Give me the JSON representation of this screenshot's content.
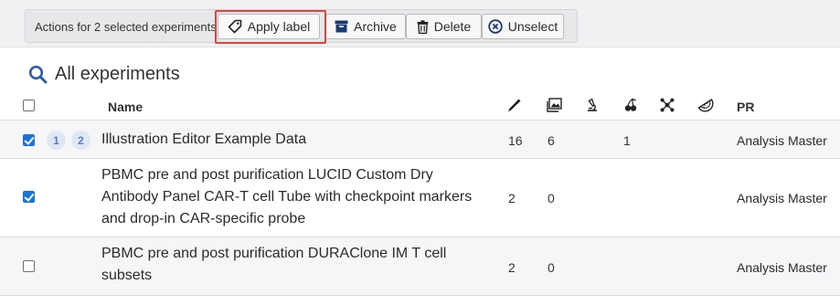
{
  "action_bar": {
    "label": "Actions for 2 selected experiments",
    "apply_label": "Apply label",
    "archive": "Archive",
    "delete": "Delete",
    "unselect": "Unselect"
  },
  "section": {
    "title": "All experiments"
  },
  "table": {
    "headers": {
      "name": "Name",
      "pr": "PR",
      "icons": [
        "pipette-icon",
        "image-gallery-icon",
        "microscope-icon",
        "cherries-icon",
        "network-nodes-icon",
        "melon-slice-icon"
      ]
    },
    "rows": [
      {
        "checked": true,
        "badges": [
          "1",
          "2"
        ],
        "name": "Illustration Editor Example Data",
        "col1": "16",
        "col2": "6",
        "col4": "1",
        "pr": "Analysis Master"
      },
      {
        "checked": true,
        "name_lines": [
          "PBMC pre and post purification LUCID Custom Dry",
          "Antibody Panel CAR-T cell Tube with checkpoint markers",
          "and drop-in CAR-specific probe"
        ],
        "col1": "2",
        "col2": "0",
        "pr": "Analysis Master"
      },
      {
        "checked": false,
        "name_lines": [
          "PBMC pre and post purification DURAClone IM T cell",
          "subsets"
        ],
        "col1": "2",
        "col2": "0",
        "pr": "Analysis Master"
      }
    ]
  },
  "colors": {
    "accent": "#1a73d9",
    "highlight": "#e0443b",
    "badge_bg": "#dfe6f4",
    "badge_text": "#5b7cc2",
    "search_icon": "#2f5fa8"
  }
}
